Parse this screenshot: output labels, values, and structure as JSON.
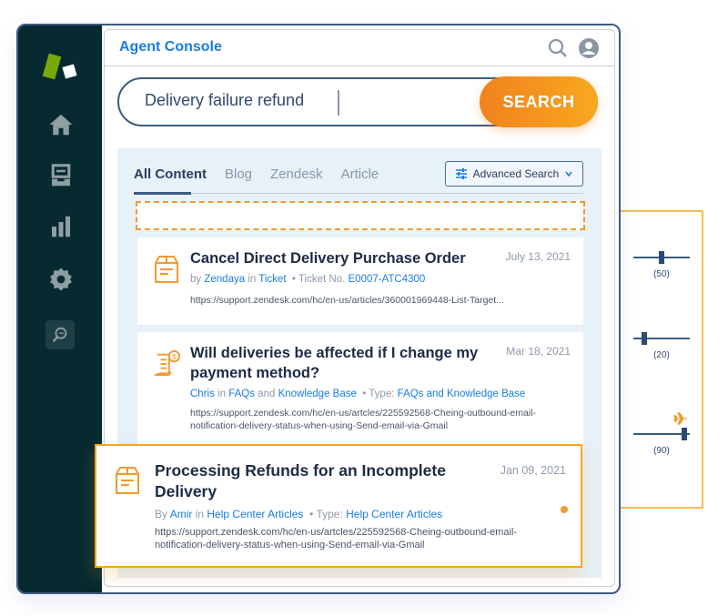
{
  "app": {
    "title": "Agent Console"
  },
  "header": {
    "icons": [
      "search-icon",
      "user-avatar-icon"
    ]
  },
  "sidebar": {
    "logo": "brand-logo",
    "items": [
      {
        "icon": "home-icon",
        "label": "Home"
      },
      {
        "icon": "inbox-tray-icon",
        "label": "Tickets"
      },
      {
        "icon": "bar-chart-icon",
        "label": "Reports"
      },
      {
        "icon": "gear-icon",
        "label": "Settings"
      },
      {
        "icon": "search-content-icon",
        "label": "Search",
        "active": true
      }
    ]
  },
  "search": {
    "value": "Delivery failure refund",
    "button_label": "SEARCH"
  },
  "tabs": [
    {
      "label": "All Content",
      "active": true
    },
    {
      "label": "Blog"
    },
    {
      "label": "Zendesk"
    },
    {
      "label": "Article"
    }
  ],
  "advanced_search": {
    "label": "Advanced Search"
  },
  "results": [
    {
      "icon": "box-document-icon",
      "title": "Cancel Direct Delivery Purchase Order",
      "date": "July 13, 2021",
      "meta": {
        "prefix": "by",
        "author": "Zendaya",
        "in": "in",
        "category": "Ticket",
        "bullet": "•",
        "field_label": "Ticket No.",
        "field_value": "E0007-ATC4300"
      },
      "url": "https://support.zendesk.com/hc/en-us/articles/360001969448-List-Target..."
    },
    {
      "icon": "receipt-dollar-icon",
      "title": "Will deliveries be affected if I change my payment method?",
      "date": "Mar 18, 2021",
      "meta": {
        "author": "Chris",
        "in": "in",
        "category": "FAQs",
        "and": "and",
        "category2": "Knowledge Base",
        "bullet": "•",
        "field_label": "Type:",
        "field_value": "FAQs and Knowledge Base"
      },
      "url": "https://support.zendesk.com/hc/en-us/artcles/225592568-Cheing-outbound-email-notification-delivery-status-when-using-Send-email-via-Gmail"
    },
    {
      "icon": "box-document-icon",
      "title": "Processing Refunds for an Incomplete Delivery",
      "date": "Jan 09, 2021",
      "meta": {
        "prefix": "By",
        "author": "Amir",
        "in": "in",
        "category": "Help Center Articles",
        "bullet": "•",
        "field_label": "Type:",
        "field_value": "Help Center Articles"
      },
      "url": "https://support.zendesk.com/hc/en-us/artcles/225592568-Cheing-outbound-email-notification-delivery-status-when-using-Send-email-via-Gmail"
    }
  ],
  "relevance_sliders": [
    {
      "value": 50,
      "label": "(50)"
    },
    {
      "value": 20,
      "label": "(20)"
    },
    {
      "value": 90,
      "label": "(90)",
      "boosted": true
    }
  ],
  "colors": {
    "accent_orange": "#f29a2e",
    "link_blue": "#1a7de0",
    "sidebar_bg": "#062a30",
    "navy": "#3e5a80"
  }
}
